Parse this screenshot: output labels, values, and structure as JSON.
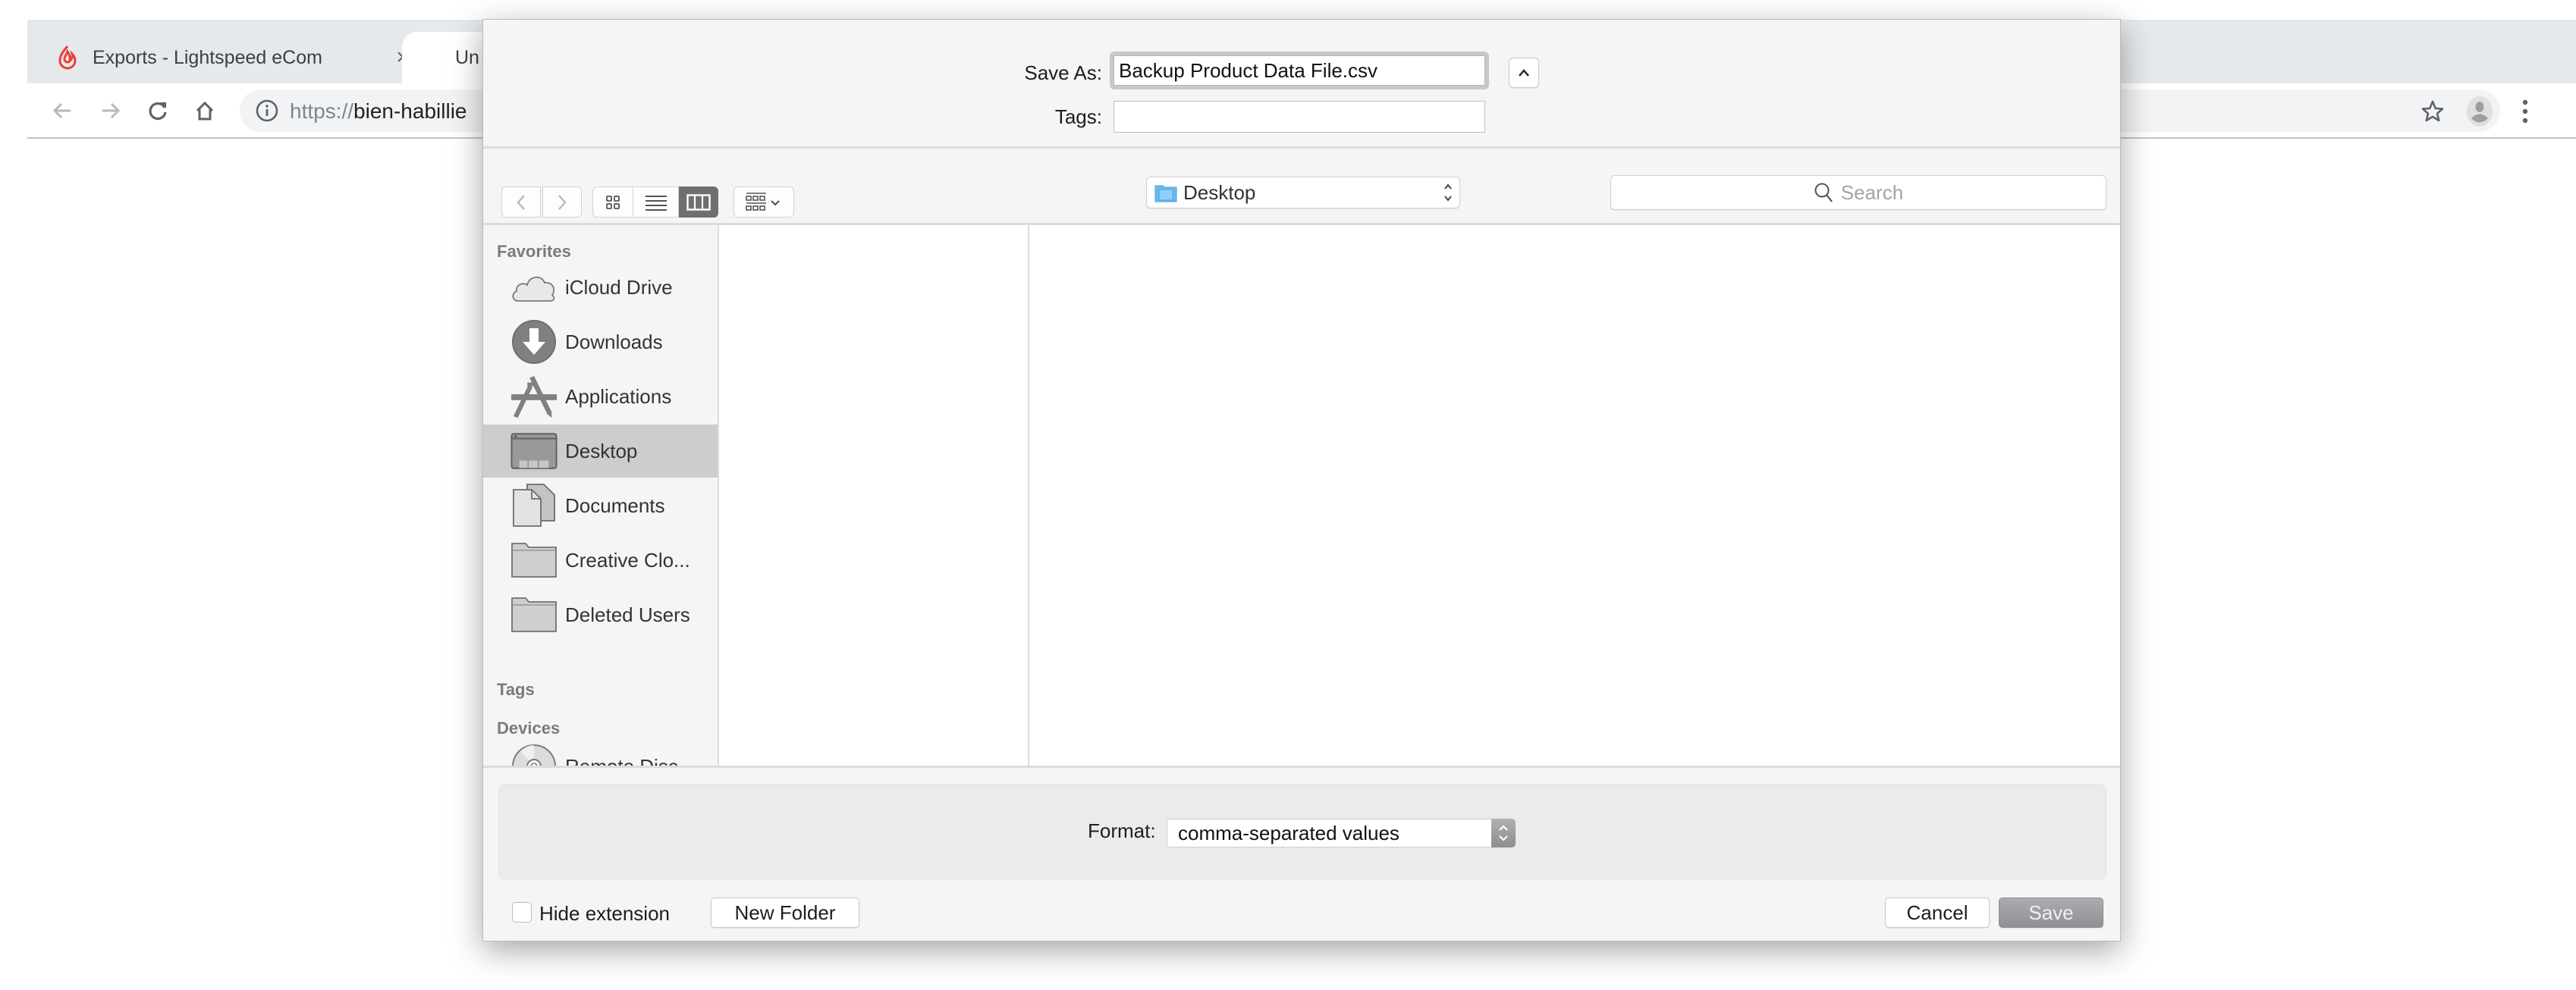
{
  "browser": {
    "tabs": [
      {
        "title": "Exports - Lightspeed eCom",
        "favicon": "lightspeed-flame-icon",
        "active": false,
        "close_glyph": "×"
      },
      {
        "title": "Un",
        "active": true
      }
    ],
    "toolbar": {
      "back_glyph": "←",
      "forward_glyph": "→",
      "reload_glyph": "↻",
      "home_glyph": "⌂",
      "url_scheme": "https://",
      "url_host": "bien-habillie",
      "bookmark_glyph": "☆",
      "menu_glyph": "⋮"
    },
    "colors": {
      "favicon": "#e8403b",
      "tabbar_bg": "#e6e9ec",
      "omnibox_bg": "#f1f3f4"
    }
  },
  "dialog": {
    "save_as_label": "Save As:",
    "save_as_value": "Backup Product Data File.csv",
    "tags_label": "Tags:",
    "tags_value": "",
    "expand_glyph": "^",
    "toolbar": {
      "back_glyph": "‹",
      "forward_glyph": "›",
      "view_modes": [
        "icon",
        "list",
        "column"
      ],
      "selected_view": "column",
      "location": "Desktop",
      "search_placeholder": "Search"
    },
    "sidebar": {
      "sections": [
        {
          "title": "Favorites",
          "items": [
            {
              "label": "iCloud Drive",
              "icon": "cloud-icon",
              "selected": false
            },
            {
              "label": "Downloads",
              "icon": "download-icon",
              "selected": false
            },
            {
              "label": "Applications",
              "icon": "applications-icon",
              "selected": false
            },
            {
              "label": "Desktop",
              "icon": "desktop-icon",
              "selected": true
            },
            {
              "label": "Documents",
              "icon": "documents-icon",
              "selected": false
            },
            {
              "label": "Creative Clo...",
              "icon": "folder-icon",
              "selected": false
            },
            {
              "label": "Deleted Users",
              "icon": "folder-icon",
              "selected": false
            }
          ]
        },
        {
          "title": "Tags",
          "items": []
        },
        {
          "title": "Devices",
          "items": [
            {
              "label": "Remote Disc",
              "icon": "disc-icon",
              "selected": false
            }
          ]
        }
      ]
    },
    "format_label": "Format:",
    "format_value": "comma-separated values",
    "hide_extension_label": "Hide extension",
    "hide_extension_checked": false,
    "new_folder_label": "New Folder",
    "cancel_label": "Cancel",
    "save_label": "Save",
    "colors": {
      "selected_row": "#cdcdcd",
      "save_button": "#9c9ca0",
      "folder_blue": "#69b9f2"
    }
  }
}
